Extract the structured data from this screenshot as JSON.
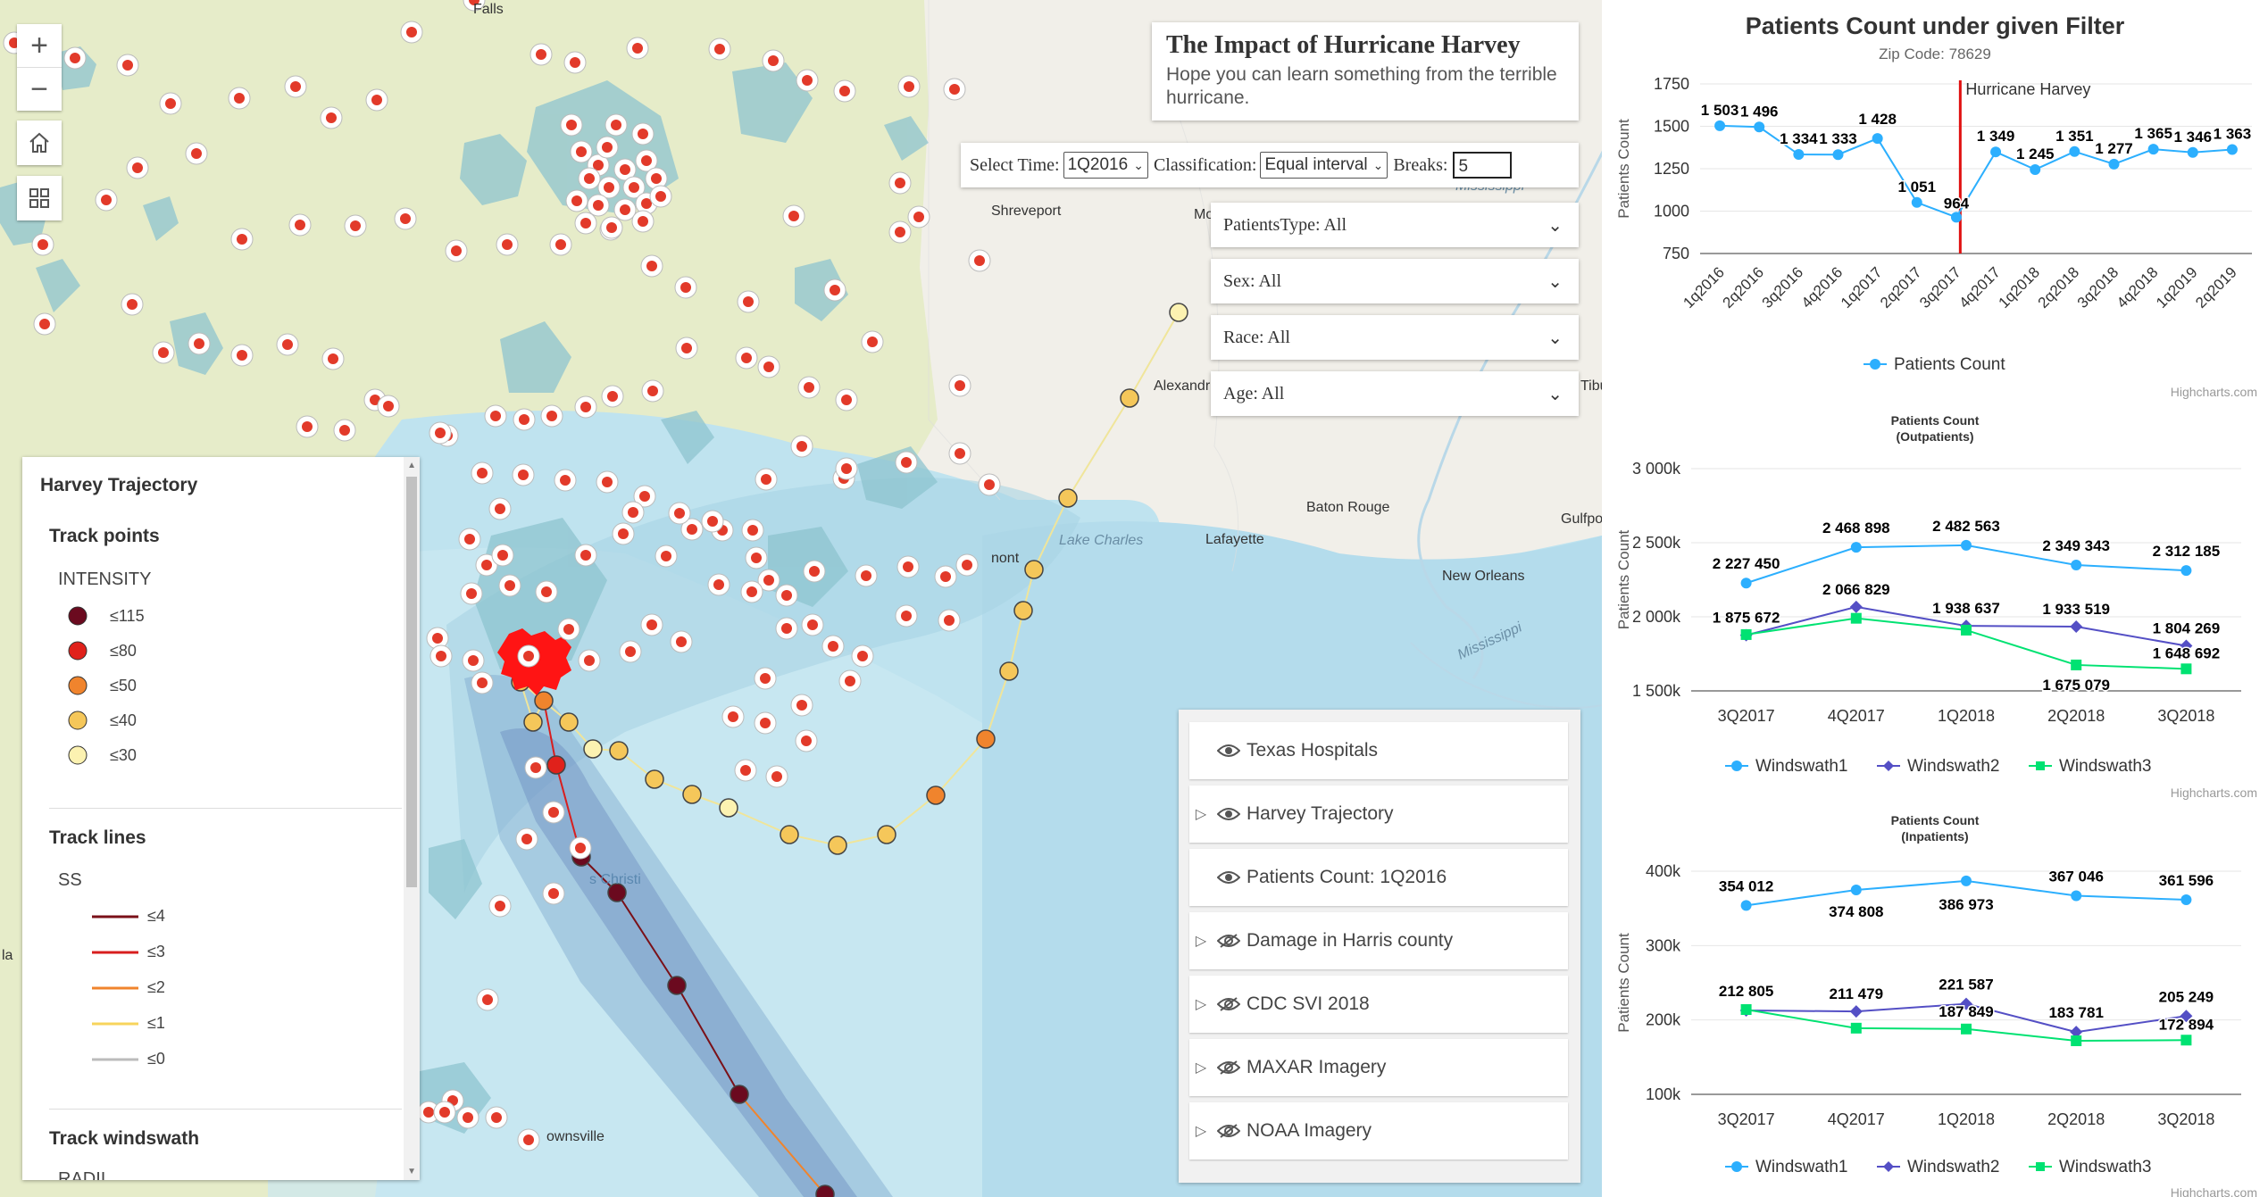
{
  "map": {
    "title": "The Impact of Hurricane Harvey",
    "subtitle": "Hope you can learn something from the terrible hurricane.",
    "filters": {
      "time_label": "Select Time:",
      "time_value": "1Q2016",
      "class_label": "Classification:",
      "class_value": "Equal interval",
      "breaks_label": "Breaks:",
      "breaks_value": "5"
    },
    "dropdowns": [
      "PatientsType: All",
      "Sex: All",
      "Race: All",
      "Age: All"
    ],
    "labels": [
      "Shreveport",
      "Alexandri",
      "Baton Rouge",
      "Lafayette",
      "Lake Charles",
      "New Orleans",
      "Gulfpo",
      "Mississippi",
      "Mississippi",
      "Falls",
      "nont",
      "s Christi",
      "ownsville",
      "Mo",
      "Tiburi",
      "la"
    ],
    "legend": {
      "title": "Harvey Trajectory",
      "track_points": "Track points",
      "intensity": "INTENSITY",
      "points": [
        {
          "label": "≤115",
          "color": "#6b0a1f"
        },
        {
          "label": "≤80",
          "color": "#e0211b"
        },
        {
          "label": "≤50",
          "color": "#f0842d"
        },
        {
          "label": "≤40",
          "color": "#f5c75a"
        },
        {
          "label": "≤30",
          "color": "#fcf2b1"
        }
      ],
      "track_lines": "Track lines",
      "ss": "SS",
      "lines": [
        {
          "label": "≤4",
          "color": "#7a1018"
        },
        {
          "label": "≤3",
          "color": "#d81e1e"
        },
        {
          "label": "≤2",
          "color": "#f0842d"
        },
        {
          "label": "≤1",
          "color": "#f7d45c"
        },
        {
          "label": "≤0",
          "color": "#bbbbbb"
        }
      ],
      "track_windswath": "Track windswath",
      "radii": "RADII"
    },
    "layers": [
      {
        "label": "Texas Hospitals",
        "expandable": false,
        "visible": true
      },
      {
        "label": "Harvey Trajectory",
        "expandable": true,
        "visible": true
      },
      {
        "label": "Patients Count: 1Q2016",
        "expandable": false,
        "visible": true
      },
      {
        "label": "Damage in Harris county",
        "expandable": true,
        "visible": false
      },
      {
        "label": "CDC SVI 2018",
        "expandable": true,
        "visible": false
      },
      {
        "label": "MAXAR Imagery",
        "expandable": true,
        "visible": false
      },
      {
        "label": "NOAA Imagery",
        "expandable": true,
        "visible": false
      }
    ]
  },
  "chart_data": [
    {
      "type": "line",
      "title": "Patients Count under given Filter",
      "subtitle": "Zip Code: 78629",
      "ylabel": "Patients Count",
      "xlabel": "",
      "categories": [
        "1q2016",
        "2q2016",
        "3q2016",
        "4q2016",
        "1q2017",
        "2q2017",
        "3q2017",
        "4q2017",
        "1q2018",
        "2q2018",
        "3q2018",
        "4q2018",
        "1q2019",
        "2q2019"
      ],
      "series": [
        {
          "name": "Patients Count",
          "color": "#2caffe",
          "values": [
            1503,
            1496,
            1334,
            1333,
            1428,
            1051,
            964,
            1349,
            1245,
            1351,
            1277,
            1365,
            1346,
            1363
          ],
          "labels": [
            "1 503",
            "1 496",
            "1 334",
            "1 333",
            "1 428",
            "1 051",
            "964",
            "1 349",
            "1 245",
            "1 351",
            "1 277",
            "1 365",
            "1 346",
            "1 363"
          ]
        }
      ],
      "yticks": [
        "750",
        "1000",
        "1250",
        "1500",
        "1750"
      ],
      "ylim": [
        750,
        1750
      ],
      "plotline": {
        "label": "Hurricane Harvey",
        "color": "#e01010",
        "after_category": "3q2017"
      },
      "credit": "Highcharts.com",
      "legend": "bottom"
    },
    {
      "type": "line",
      "title": "Patients Count",
      "subtitle": "(Outpatients)",
      "ylabel": "Patients Count",
      "categories": [
        "3Q2017",
        "4Q2017",
        "1Q2018",
        "2Q2018",
        "3Q2018"
      ],
      "series": [
        {
          "name": "Windswath1",
          "color": "#2caffe",
          "marker": "circle",
          "values": [
            2227450,
            2468898,
            2482563,
            2349343,
            2312185
          ],
          "labels": [
            "2 227 450",
            "2 468 898",
            "2 482 563",
            "2 349 343",
            "2 312 185"
          ]
        },
        {
          "name": "Windswath2",
          "color": "#544fc5",
          "marker": "diamond",
          "values": [
            1875672,
            2066829,
            1938637,
            1933519,
            1804269
          ],
          "labels": [
            "1 875 672",
            "2 066 829",
            "1 938 637",
            "1 933 519",
            "1 804 269"
          ]
        },
        {
          "name": "Windswath3",
          "color": "#00e272",
          "marker": "square",
          "values": [
            1880000,
            1990000,
            1910000,
            1675079,
            1648692
          ],
          "labels": [
            "",
            "",
            "",
            "1 675 079",
            "1 648 692"
          ]
        }
      ],
      "yticks": [
        "1 500k",
        "2 000k",
        "2 500k",
        "3 000k"
      ],
      "ylim": [
        1500000,
        3000000
      ],
      "credit": "Highcharts.com",
      "legend": "bottom"
    },
    {
      "type": "line",
      "title": "Patients Count",
      "subtitle": "(Inpatients)",
      "ylabel": "Patients Count",
      "categories": [
        "3Q2017",
        "4Q2017",
        "1Q2018",
        "2Q2018",
        "3Q2018"
      ],
      "series": [
        {
          "name": "Windswath1",
          "color": "#2caffe",
          "marker": "circle",
          "values": [
            354012,
            374808,
            386973,
            367046,
            361596
          ],
          "labels": [
            "354 012",
            "374 808",
            "386 973",
            "367 046",
            "361 596"
          ]
        },
        {
          "name": "Windswath2",
          "color": "#544fc5",
          "marker": "diamond",
          "values": [
            212805,
            211479,
            221587,
            183781,
            205249
          ],
          "labels": [
            "212 805",
            "211 479",
            "221 587",
            "183 781",
            "205 249"
          ]
        },
        {
          "name": "Windswath3",
          "color": "#00e272",
          "marker": "square",
          "values": [
            214000,
            189000,
            187849,
            172000,
            172894
          ],
          "labels": [
            "",
            "",
            "187 849",
            "",
            "172 894"
          ]
        }
      ],
      "yticks": [
        "100k",
        "200k",
        "300k",
        "400k"
      ],
      "ylim": [
        100000,
        400000
      ],
      "credit": "Highcharts.com",
      "legend": "bottom"
    }
  ]
}
